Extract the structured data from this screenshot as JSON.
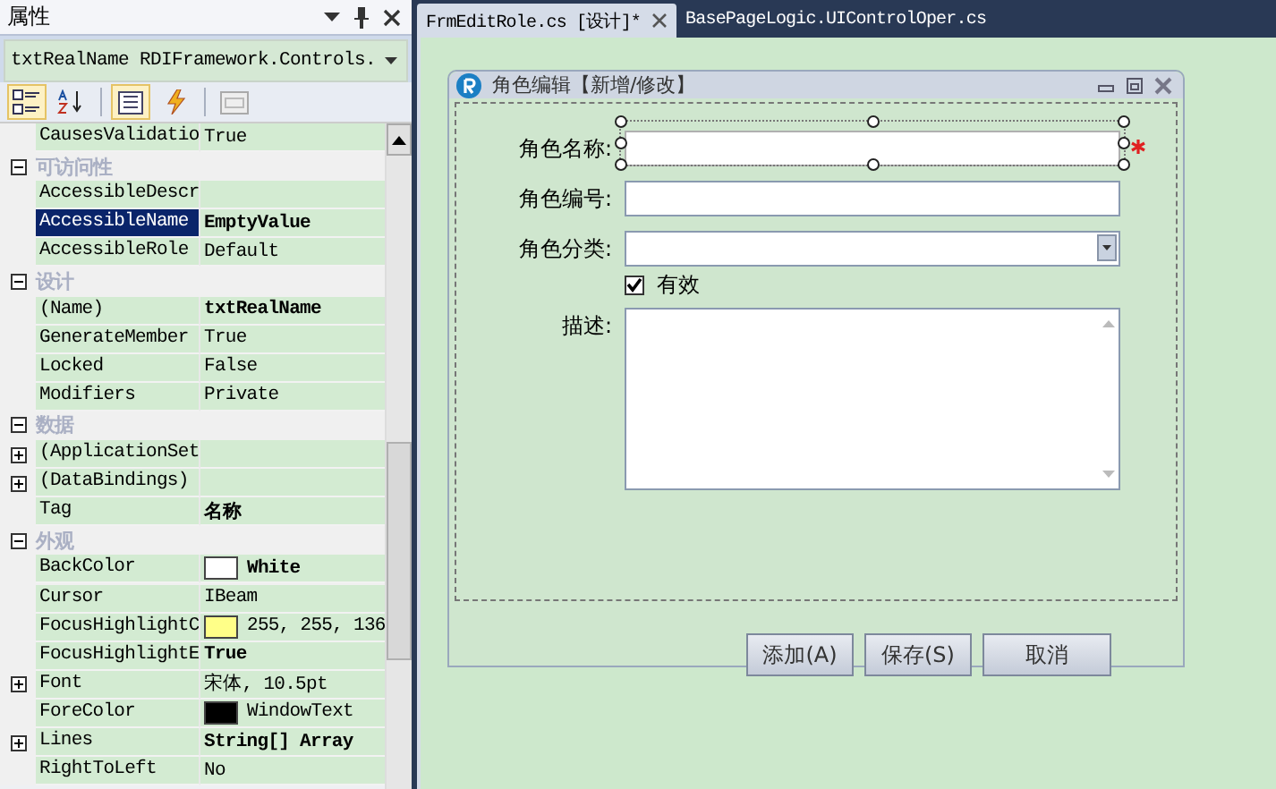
{
  "properties_panel": {
    "title": "属性",
    "object_selector": "txtRealName RDIFramework.Controls.",
    "toolbar": [
      {
        "kind": "categorized",
        "selected": true
      },
      {
        "kind": "alphabetical",
        "selected": false
      },
      {
        "kind": "properties",
        "selected": true
      },
      {
        "kind": "events",
        "selected": false
      },
      {
        "kind": "pages",
        "selected": false
      }
    ],
    "rows": [
      {
        "kind": "property",
        "name": "CausesValidatio",
        "value": "True",
        "modified": false,
        "selected": false
      },
      {
        "kind": "category",
        "name": "可访问性",
        "expanded": true
      },
      {
        "kind": "property",
        "name": "AccessibleDescr",
        "value": "",
        "selected": false
      },
      {
        "kind": "property",
        "name": "AccessibleName",
        "value": "EmptyValue",
        "modified": true,
        "selected": true
      },
      {
        "kind": "property",
        "name": "AccessibleRole",
        "value": "Default",
        "modified": false,
        "selected": false
      },
      {
        "kind": "category",
        "name": "设计",
        "expanded": true
      },
      {
        "kind": "property",
        "name": "(Name)",
        "value": "txtRealName",
        "modified": true,
        "selected": false
      },
      {
        "kind": "property",
        "name": "GenerateMember",
        "value": "True",
        "modified": false,
        "selected": false
      },
      {
        "kind": "property",
        "name": "Locked",
        "value": "False",
        "modified": false,
        "selected": false
      },
      {
        "kind": "property",
        "name": "Modifiers",
        "value": "Private",
        "modified": false,
        "selected": false
      },
      {
        "kind": "category",
        "name": "数据",
        "expanded": true
      },
      {
        "kind": "property",
        "name": "(ApplicationSet",
        "value": "",
        "selected": false,
        "expanded": false
      },
      {
        "kind": "property",
        "name": "(DataBindings)",
        "value": "",
        "selected": false,
        "expanded": false
      },
      {
        "kind": "property",
        "name": "Tag",
        "value": "名称",
        "modified": true,
        "selected": false
      },
      {
        "kind": "category",
        "name": "外观",
        "expanded": true
      },
      {
        "kind": "property",
        "name": "BackColor",
        "value": "White",
        "modified": true,
        "selected": false,
        "color": "#ffffff"
      },
      {
        "kind": "property",
        "name": "Cursor",
        "value": "IBeam",
        "modified": false,
        "selected": false
      },
      {
        "kind": "property",
        "name": "FocusHighlightC",
        "value": "255, 255, 136",
        "modified": false,
        "selected": false,
        "color": "#ffff88"
      },
      {
        "kind": "property",
        "name": "FocusHighlightE",
        "value": "True",
        "modified": true,
        "selected": false
      },
      {
        "kind": "property",
        "name": "Font",
        "value": "宋体, 10.5pt",
        "modified": false,
        "selected": false,
        "expanded": false
      },
      {
        "kind": "property",
        "name": "ForeColor",
        "value": "WindowText",
        "modified": false,
        "selected": false,
        "color": "#000000"
      },
      {
        "kind": "property",
        "name": "Lines",
        "value": "String[] Array",
        "modified": true,
        "selected": false,
        "expanded": false
      },
      {
        "kind": "property",
        "name": "RightToLeft",
        "value": "No",
        "modified": false,
        "selected": false
      }
    ]
  },
  "document_tabs": [
    {
      "label": "FrmEditRole.cs [设计]*",
      "selected": true
    },
    {
      "label": "BasePageLogic.UIControlOper.cs",
      "selected": false
    }
  ],
  "form": {
    "title": "角色编辑【新增/修改】",
    "fields": [
      {
        "kind": "text",
        "label": "角色名称:",
        "selected": true,
        "required": true
      },
      {
        "kind": "text",
        "label": "角色编号:",
        "selected": false,
        "required": false
      },
      {
        "kind": "combo",
        "label": "角色分类:",
        "selected": false,
        "required": false
      },
      {
        "kind": "checkbox",
        "label": "有效",
        "checked": true
      },
      {
        "kind": "memo",
        "label": "描述:",
        "selected": false,
        "required": false
      }
    ],
    "buttons": [
      "添加(A)",
      "保存(S)",
      "取消"
    ]
  }
}
